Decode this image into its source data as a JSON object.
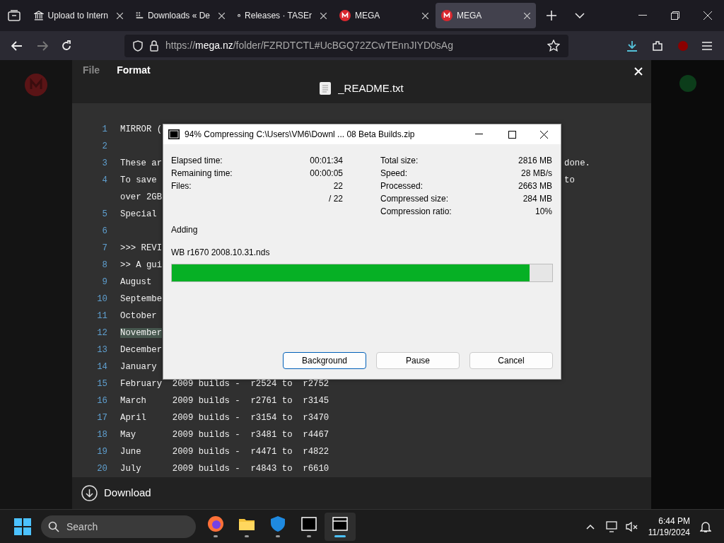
{
  "browser": {
    "tabs": [
      {
        "kind": "archive",
        "title": "Upload to Intern",
        "selected": false
      },
      {
        "kind": "dots",
        "title": "Downloads « De",
        "selected": false
      },
      {
        "kind": "github",
        "title": "Releases · TASEr",
        "selected": false
      },
      {
        "kind": "mega",
        "title": "MEGA",
        "selected": false
      },
      {
        "kind": "mega",
        "title": "MEGA",
        "selected": true
      }
    ],
    "url": {
      "scheme": "https://",
      "host": "mega.nz",
      "path": "/folder/FZRDTCTL#UcBGQ72ZCwTEnnJIYD0sAg"
    }
  },
  "viewer": {
    "menu": [
      "File",
      "Format"
    ],
    "file_name": "_README.txt",
    "lines": [
      {
        "number": "1",
        "text": "MIRROR (",
        "highlighted": false
      },
      {
        "number": "2"
      },
      {
        "number": "3",
        "text": "These ar",
        "tail": "done.",
        "highlighted": false
      },
      {
        "number": "4",
        "text": "To save",
        "tail": "to",
        "highlighted": false
      },
      {
        "text": "over 2GB",
        "highlighted": false
      },
      {
        "number": "5",
        "text": "Special",
        "highlighted": false
      },
      {
        "number": "6"
      },
      {
        "number": "7",
        "text": ">>> REVI",
        "highlighted": false
      },
      {
        "number": "8",
        "text": ">> A gui",
        "highlighted": false
      },
      {
        "number": "9",
        "text": "August",
        "highlighted": false
      },
      {
        "number": "10",
        "text": "Septembe",
        "highlighted": false
      },
      {
        "number": "11",
        "text": "October",
        "highlighted": false
      },
      {
        "number": "12",
        "text": "November",
        "highlighted": true
      },
      {
        "number": "13",
        "text": "December",
        "highlighted": false
      },
      {
        "number": "14",
        "text": "January",
        "highlighted": false
      },
      {
        "number": "15",
        "text": "February  2009 builds -  r2524 to  r2752",
        "highlighted": false
      },
      {
        "number": "16",
        "text": "March     2009 builds -  r2761 to  r3145",
        "highlighted": false
      },
      {
        "number": "17",
        "text": "April     2009 builds -  r3154 to  r3470",
        "highlighted": false
      },
      {
        "number": "18",
        "text": "May       2009 builds -  r3481 to  r4467",
        "highlighted": false
      },
      {
        "number": "19",
        "text": "June      2009 builds -  r4471 to  r4822",
        "highlighted": false
      },
      {
        "number": "20",
        "text": "July      2009 builds -  r4843 to  r6610",
        "highlighted": false
      }
    ],
    "download_label": "Download"
  },
  "dialog": {
    "title": "94% Compressing C:\\Users\\VM6\\Downl ... 08 Beta Builds.zip",
    "left_stats": [
      {
        "label": "Elapsed time:",
        "value": "00:01:34"
      },
      {
        "label": "Remaining time:",
        "value": "00:00:05"
      },
      {
        "label": "Files:",
        "value": "22"
      },
      {
        "value": "/ 22"
      }
    ],
    "right_stats": [
      {
        "label": "Total size:",
        "value": "2816 MB"
      },
      {
        "label": "Speed:",
        "value": "28 MB/s"
      },
      {
        "label": "Processed:",
        "value": "2663 MB"
      },
      {
        "label": "Compressed size:",
        "value": "284 MB"
      },
      {
        "label": "Compression ratio:",
        "value": "10%"
      }
    ],
    "action": "Adding",
    "current_file": "WB r1670 2008.10.31.nds",
    "level": 0.94,
    "buttons": [
      {
        "label": "Background",
        "default": true
      },
      {
        "label": "Pause",
        "default": false
      },
      {
        "label": "Cancel",
        "default": false
      }
    ]
  },
  "taskbar": {
    "search_placeholder": "Search",
    "apps": [
      {
        "kind": "firefox",
        "selected": false
      },
      {
        "kind": "folder",
        "selected": false
      },
      {
        "kind": "shield",
        "selected": false
      },
      {
        "kind": "archiver",
        "selected": false
      },
      {
        "kind": "archiver-fm",
        "selected": true
      }
    ],
    "time": "6:44 PM",
    "date": "11/19/2024"
  }
}
